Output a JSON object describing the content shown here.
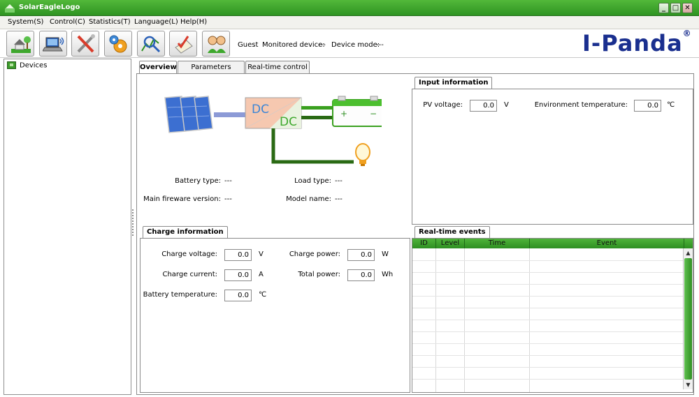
{
  "window": {
    "title": "SolarEagleLogo"
  },
  "menu": [
    "System(S)",
    "Control(C)",
    "Statistics(T)",
    "Language(L)",
    "Help(H)"
  ],
  "toolbar": {
    "buttons": [
      "home-icon",
      "monitor-icon",
      "tools-icon",
      "settings-gear-icon",
      "search-chart-icon",
      "checklist-icon",
      "users-icon"
    ],
    "user": "Guest",
    "monitored_device_label": "Monitored device:",
    "monitored_device_value": "---",
    "device_mode_label": "Device mode:",
    "device_mode_value": "---"
  },
  "logo": {
    "text": "I-Panda",
    "mark": "®"
  },
  "tree": {
    "root": "Devices"
  },
  "tabs": [
    "Overview",
    "Parameters setting",
    "Real-time control"
  ],
  "diagram": {
    "dc_in": "DC",
    "dc_out": "DC",
    "battery_plus": "+",
    "battery_minus": "−"
  },
  "overview": {
    "battery_type_label": "Battery type:",
    "battery_type_value": "---",
    "load_type_label": "Load type:",
    "load_type_value": "---",
    "firmware_label": "Main fireware version:",
    "firmware_value": "---",
    "model_label": "Model name:",
    "model_value": "---"
  },
  "input_info": {
    "title": "Input information",
    "pv_voltage_label": "PV voltage:",
    "pv_voltage_value": "0.0",
    "pv_voltage_unit": "V",
    "env_temp_label": "Environment temperature:",
    "env_temp_value": "0.0",
    "env_temp_unit": "℃"
  },
  "charge_info": {
    "title": "Charge information",
    "charge_voltage_label": "Charge voltage:",
    "charge_voltage_value": "0.0",
    "charge_voltage_unit": "V",
    "charge_current_label": "Charge current:",
    "charge_current_value": "0.0",
    "charge_current_unit": "A",
    "battery_temp_label": "Battery temperature:",
    "battery_temp_value": "0.0",
    "battery_temp_unit": "℃",
    "charge_power_label": "Charge power:",
    "charge_power_value": "0.0",
    "charge_power_unit": "W",
    "total_power_label": "Total power:",
    "total_power_value": "0.0",
    "total_power_unit": "Wh"
  },
  "events": {
    "title": "Real-time events",
    "columns": [
      "ID",
      "Level",
      "Time",
      "Event"
    ]
  }
}
